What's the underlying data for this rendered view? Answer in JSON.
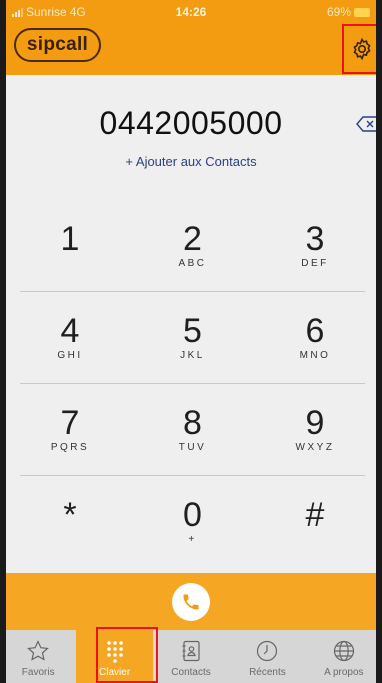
{
  "status_bar": {
    "carrier": "Sunrise",
    "network": "4G",
    "time": "14:26",
    "battery": "69%"
  },
  "header": {
    "logo": "sipcall",
    "settings_icon": "gear-icon"
  },
  "dialer": {
    "number": "0442005000",
    "add_contact": "+ Ajouter aux Contacts"
  },
  "keypad": [
    [
      {
        "digit": "1",
        "letters": ""
      },
      {
        "digit": "2",
        "letters": "ABC"
      },
      {
        "digit": "3",
        "letters": "DEF"
      }
    ],
    [
      {
        "digit": "4",
        "letters": "GHI"
      },
      {
        "digit": "5",
        "letters": "JKL"
      },
      {
        "digit": "6",
        "letters": "MNO"
      }
    ],
    [
      {
        "digit": "7",
        "letters": "PQRS"
      },
      {
        "digit": "8",
        "letters": "TUV"
      },
      {
        "digit": "9",
        "letters": "WXYZ"
      }
    ],
    [
      {
        "digit": "*",
        "letters": ""
      },
      {
        "digit": "0",
        "letters": "+"
      },
      {
        "digit": "#",
        "letters": ""
      }
    ]
  ],
  "tabs": [
    {
      "label": "Favoris",
      "icon": "star-icon",
      "active": false
    },
    {
      "label": "Clavier",
      "icon": "keypad-icon",
      "active": true
    },
    {
      "label": "Contacts",
      "icon": "contacts-icon",
      "active": false
    },
    {
      "label": "Récents",
      "icon": "clock-icon",
      "active": false
    },
    {
      "label": "A propos",
      "icon": "globe-icon",
      "active": false
    }
  ],
  "colors": {
    "accent": "#f39c12",
    "call_bar": "#f5a623",
    "highlight": "#e8141a",
    "link": "#2b3f8a"
  }
}
